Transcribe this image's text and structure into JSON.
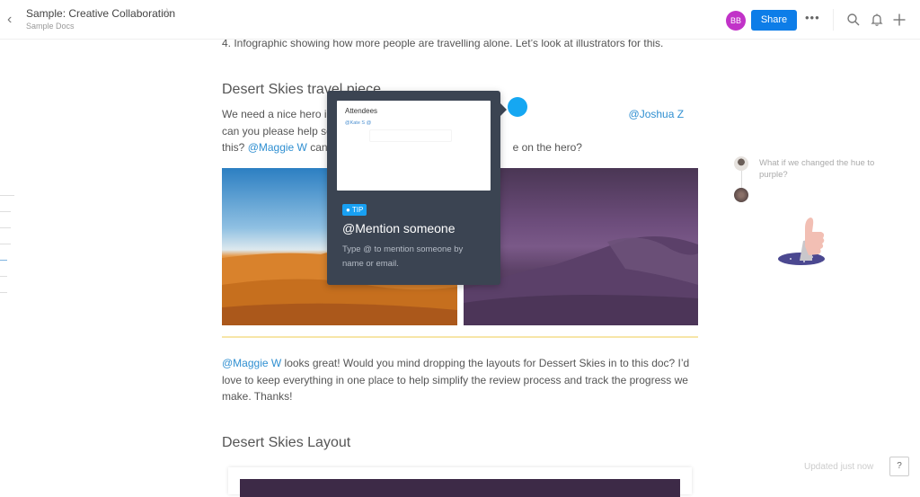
{
  "header": {
    "back_icon": "chevron-left-icon",
    "title": "Sample: Creative Collaboration",
    "star_icon": "star-outline-icon",
    "folder": "Sample Docs",
    "avatar_initials": "BB",
    "avatar_color": "#c133c8",
    "share_label": "Share",
    "share_color": "#0d7de8",
    "more_label": "•••",
    "search_icon": "search-icon",
    "bell_icon": "bell-icon",
    "plus_icon": "plus-icon"
  },
  "document": {
    "list_item": "4.   Infographic showing how more people are travelling alone. Let’s look at illustrators for this.",
    "section1": {
      "heading": "Desert Skies travel piece",
      "para_line1_pre": "We need a nice hero i",
      "para_line1_mention": "@Joshua Z",
      "para_line1_post": " can you please help source",
      "para_line2_pre": "this? ",
      "para_line2_mention": "@Maggie W",
      "para_line2_mid": " can",
      "para_line2_post": "e on the hero?"
    },
    "images": [
      {
        "name": "desert-orange",
        "description": "Orange desert dunes under blue sky"
      },
      {
        "name": "desert-purple",
        "description": "Purple-tinted desert dunes"
      }
    ],
    "section2": {
      "mention": "@Maggie W",
      "text_line1": " looks great! Would you mind dropping the layouts for Dessert Skies in to this doc? I’d",
      "text_line2": "love to keep everything in one place to help simplify the review process and track the progress we",
      "text_line3": "make. Thanks!"
    },
    "section3": {
      "heading": "Desert Skies Layout"
    }
  },
  "tip": {
    "preview_title": "Attendees",
    "preview_mention": "@Kate S @",
    "badge_icon": "lightbulb-icon",
    "badge_label": "TIP",
    "badge_color": "#18a0f2",
    "title": "@Mention someone",
    "description": "Type @ to mention someone by name or email."
  },
  "comments": {
    "text": "What if we changed the hue to purple?",
    "illustration": "thumbs-up-icon"
  },
  "footer": {
    "status": "Updated just now",
    "help_label": "?"
  }
}
